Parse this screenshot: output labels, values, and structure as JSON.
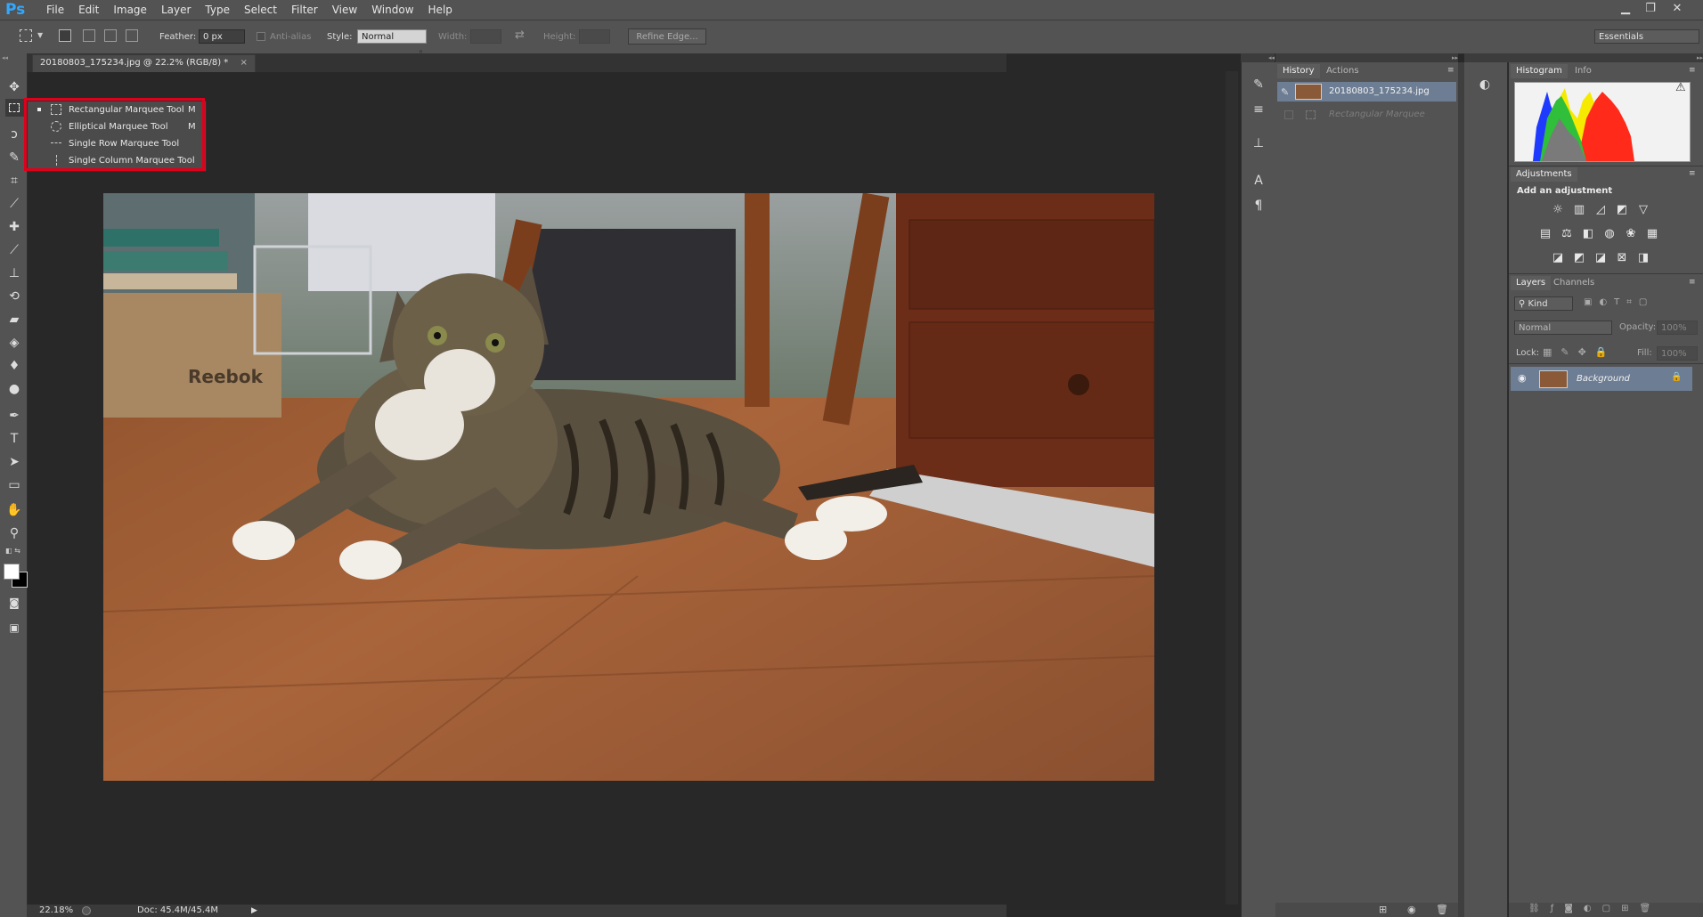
{
  "app": {
    "logo": "Ps"
  },
  "menu": [
    "File",
    "Edit",
    "Image",
    "Layer",
    "Type",
    "Select",
    "Filter",
    "View",
    "Window",
    "Help"
  ],
  "options": {
    "feather_label": "Feather:",
    "feather_value": "0 px",
    "antialias_label": "Anti-alias",
    "style_label": "Style:",
    "style_value": "Normal",
    "width_label": "Width:",
    "height_label": "Height:",
    "refine_label": "Refine Edge...",
    "workspace": "Essentials"
  },
  "document": {
    "tab_title": "20180803_175234.jpg @ 22.2% (RGB/8) *",
    "close_glyph": "×"
  },
  "flyout": [
    {
      "label": "Rectangular Marquee Tool",
      "key": "M",
      "selected": true
    },
    {
      "label": "Elliptical Marquee Tool",
      "key": "M",
      "selected": false
    },
    {
      "label": "Single Row Marquee Tool",
      "key": "",
      "selected": false
    },
    {
      "label": "Single Column Marquee Tool",
      "key": "",
      "selected": false
    }
  ],
  "photo_text": "Reebok",
  "status": {
    "zoom": "22.18%",
    "doc": "Doc: 45.4M/45.4M"
  },
  "history_panel": {
    "tabs": [
      "History",
      "Actions"
    ],
    "snapshot": "20180803_175234.jpg",
    "step": "Rectangular Marquee"
  },
  "histogram_panel": {
    "tabs": [
      "Histogram",
      "Info"
    ],
    "warning": "⚠"
  },
  "adjustments_panel": {
    "tab": "Adjustments",
    "heading": "Add an adjustment"
  },
  "layers_panel": {
    "tabs": [
      "Layers",
      "Channels"
    ],
    "filter": "Kind",
    "blend": "Normal",
    "opacity_label": "Opacity:",
    "opacity_value": "100%",
    "lock_label": "Lock:",
    "fill_label": "Fill:",
    "fill_value": "100%",
    "layer_name": "Background"
  },
  "colors": {
    "selection_blue": "#6d7d94",
    "highlight_red": "#e0001b",
    "ps_blue": "#31a8ff"
  }
}
